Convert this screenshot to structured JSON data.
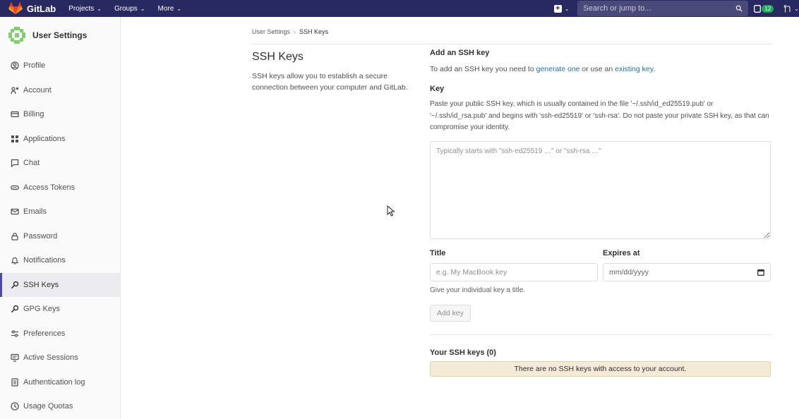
{
  "topnav": {
    "brand": "GitLab",
    "links": [
      "Projects",
      "Groups",
      "More"
    ],
    "search_placeholder": "Search or jump to...",
    "todo_count": "12"
  },
  "sidebar": {
    "title": "User Settings",
    "items": [
      {
        "label": "Profile",
        "icon": "profile-icon"
      },
      {
        "label": "Account",
        "icon": "account-icon"
      },
      {
        "label": "Billing",
        "icon": "billing-icon"
      },
      {
        "label": "Applications",
        "icon": "applications-icon"
      },
      {
        "label": "Chat",
        "icon": "chat-icon"
      },
      {
        "label": "Access Tokens",
        "icon": "token-icon"
      },
      {
        "label": "Emails",
        "icon": "mail-icon"
      },
      {
        "label": "Password",
        "icon": "lock-icon"
      },
      {
        "label": "Notifications",
        "icon": "bell-icon"
      },
      {
        "label": "SSH Keys",
        "icon": "key-icon",
        "active": true
      },
      {
        "label": "GPG Keys",
        "icon": "key-icon"
      },
      {
        "label": "Preferences",
        "icon": "preferences-icon"
      },
      {
        "label": "Active Sessions",
        "icon": "monitor-icon"
      },
      {
        "label": "Authentication log",
        "icon": "log-icon"
      },
      {
        "label": "Usage Quotas",
        "icon": "quota-icon"
      }
    ]
  },
  "breadcrumb": {
    "parent": "User Settings",
    "current": "SSH Keys"
  },
  "intro": {
    "title": "SSH Keys",
    "description": "SSH keys allow you to establish a secure connection between your computer and GitLab."
  },
  "add_key": {
    "title": "Add an SSH key",
    "text_before": "To add an SSH key you need to ",
    "link1": "generate one",
    "text_mid": " or use an ",
    "link2": "existing key",
    "text_after": ".",
    "key_label": "Key",
    "key_help": "Paste your public SSH key, which is usually contained in the file '~/.ssh/id_ed25519.pub' or '~/.ssh/id_rsa.pub' and begins with 'ssh-ed25519' or 'ssh-rsa'. Do not paste your private SSH key, as that can compromise your identity.",
    "key_placeholder": "Typically starts with \"ssh-ed25519 …\" or \"ssh-rsa …\"",
    "title_label": "Title",
    "title_placeholder": "e.g. My MacBook key",
    "title_help": "Give your individual key a title.",
    "expires_label": "Expires at",
    "expires_placeholder": "mm/dd/yyyy",
    "button": "Add key"
  },
  "your_keys": {
    "title": "Your SSH keys (0)",
    "empty": "There are no SSH keys with access to your account."
  },
  "colors": {
    "nav_bg": "#292961",
    "active_bar": "#4b4ba3",
    "link": "#1f6fb5",
    "alert_bg": "#f3ead7"
  }
}
